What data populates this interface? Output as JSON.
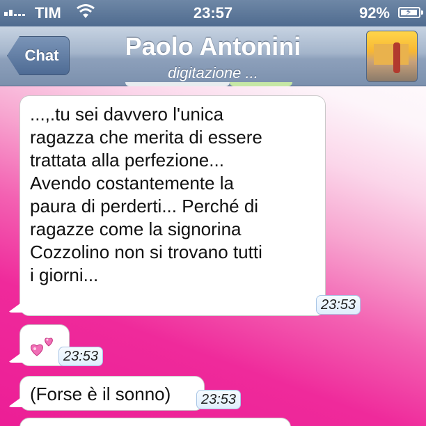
{
  "status_bar": {
    "carrier": "TIM",
    "time": "23:57",
    "battery_percent": "92%",
    "signal_icon": "signal-bars-icon",
    "wifi_icon": "wifi-icon",
    "battery_icon": "battery-charging-icon"
  },
  "nav": {
    "back_label": "Chat",
    "contact_name": "Paolo Antonini",
    "status": "digitazione ..."
  },
  "messages": [
    {
      "text": "...,.tu sei davvero l'unica\nragazza che merita di essere\ntrattata alla perfezione...\nAvendo costantemente la\npaura di perderti... Perché di\nragazze come la signorina\nCozzolino non si trovano tutti\ni giorni...",
      "time": "23:53"
    },
    {
      "icon": "two-hearts-icon",
      "time": "23:53"
    },
    {
      "text": "(Forse è il sonno)",
      "time": "23:53"
    }
  ],
  "colors": {
    "nav_bar": "#8da0bb",
    "status_bar": "#5a7399",
    "bubble": "#ffffff",
    "timestamp_bg": "#e4f0fd",
    "background_pink": "#ec1e96"
  }
}
